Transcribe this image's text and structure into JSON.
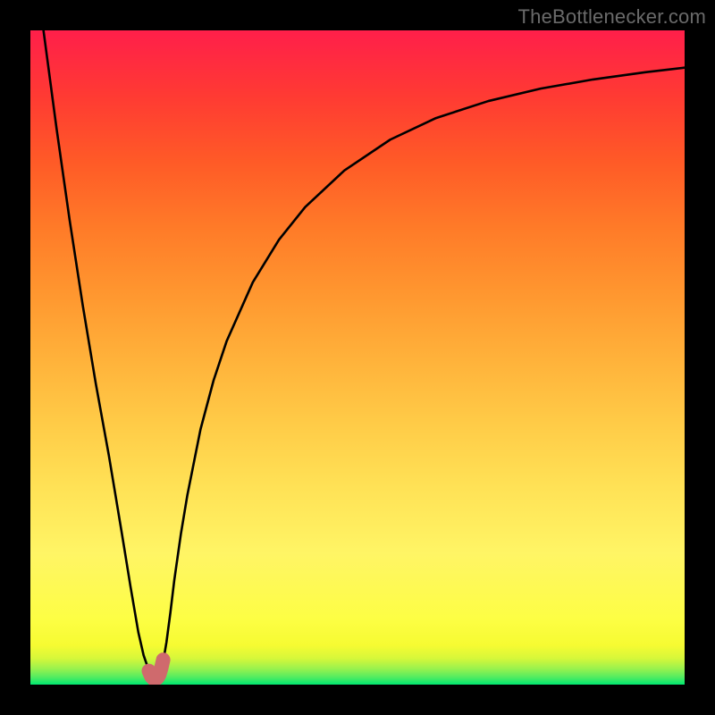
{
  "watermark": {
    "text": "TheBottlenecker.com"
  },
  "colors": {
    "frame": "#000000",
    "curve_stroke": "#000000",
    "pink_stroke": "#cf6a6d",
    "gradient_top": "#ff1f4a",
    "gradient_bottom": "#00e871"
  },
  "chart_data": {
    "type": "line",
    "title": "",
    "xlabel": "",
    "ylabel": "",
    "xlim": [
      0,
      100
    ],
    "ylim": [
      0,
      100
    ],
    "grid": false,
    "legend": false,
    "series": [
      {
        "name": "bottleneck-curve",
        "x": [
          0,
          2,
          4,
          6,
          8,
          10,
          12,
          14,
          15.3,
          16.5,
          17.3,
          18.1,
          18.9,
          19.5,
          19.8,
          20.3,
          20.8,
          21.4,
          22,
          23,
          24,
          26,
          28,
          30,
          34,
          38,
          42,
          48,
          55,
          62,
          70,
          78,
          86,
          94,
          100
        ],
        "y": [
          116,
          100,
          85,
          71,
          58,
          46,
          35,
          23,
          15,
          8,
          4.5,
          2.2,
          1.2,
          1.2,
          1.7,
          3.5,
          6.5,
          11,
          16,
          23,
          29,
          39,
          46.5,
          52.5,
          61.5,
          68,
          73,
          78.6,
          83.3,
          86.6,
          89.2,
          91.1,
          92.5,
          93.6,
          94.3
        ]
      },
      {
        "name": "minimum-marker",
        "x": [
          18.1,
          18.5,
          18.8,
          19.1,
          19.4,
          19.7,
          20.0,
          20.3
        ],
        "y": [
          2.1,
          1.2,
          0.9,
          0.9,
          1.0,
          1.5,
          2.5,
          3.8
        ]
      }
    ]
  }
}
